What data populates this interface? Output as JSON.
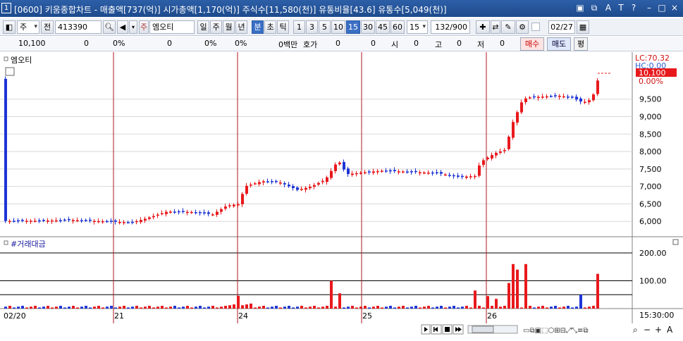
{
  "window": {
    "num": "1",
    "title": "[0600] 키움종합차트 - 매출액[737(억)] 시가총액[1,170(억)] 주식수[11,580(천)] 유통비율[43.6] 유통수[5,049(천)]"
  },
  "toolbar": {
    "period_combo": "주",
    "prev_label": "전",
    "stock_code": "413390",
    "stock_name": "엠오티",
    "intervals": [
      "일",
      "주",
      "월",
      "년",
      "분",
      "초",
      "틱"
    ],
    "active_interval": "분",
    "minute_options": [
      "1",
      "3",
      "5",
      "10",
      "15",
      "30",
      "45",
      "60"
    ],
    "active_minute": "15",
    "minute_combo": "15",
    "count": "132/900",
    "date": "02/27"
  },
  "inforow": {
    "price": "10,100",
    "change": "0",
    "change_pct": "0%",
    "volume": "0",
    "volume_pct": "0%",
    "vol_ratio": "0%",
    "amount": "0백만",
    "bid_label": "호가",
    "bid_vals": [
      "0",
      "0"
    ],
    "open_label": "시",
    "open_val": "0",
    "high_label": "고",
    "high_val": "0",
    "low_label": "저",
    "low_val": "0",
    "buy": "매수",
    "sell": "매도",
    "avg": "평"
  },
  "chart": {
    "price_title": "엠오티",
    "volume_title": "#거래대금",
    "lc_label": "LC:70.32",
    "hc_label": "HC:0.00",
    "current_price_tag": "10,100",
    "pct_label": "0.00%",
    "price_ticks": [
      "9,500",
      "9,000",
      "8,500",
      "8,000",
      "7,500",
      "7,000",
      "6,500",
      "6,000"
    ],
    "amount_ticks": [
      "200.00",
      "100.00"
    ],
    "date_labels": [
      "02/20",
      "21",
      "24",
      "25",
      "26"
    ],
    "time_label": "15:30:00",
    "colors": {
      "up": "#e8191c",
      "down": "#1e35d6",
      "sep": "#b0171f"
    }
  },
  "chart_data": {
    "type": "candlestick",
    "interval": "15분",
    "days": [
      "02/20",
      "21",
      "24",
      "25",
      "26"
    ],
    "price_range": [
      5700,
      10600
    ],
    "amount_range": [
      0,
      230
    ],
    "last_price": 10100,
    "lc": 70.32,
    "hc": 0.0
  }
}
